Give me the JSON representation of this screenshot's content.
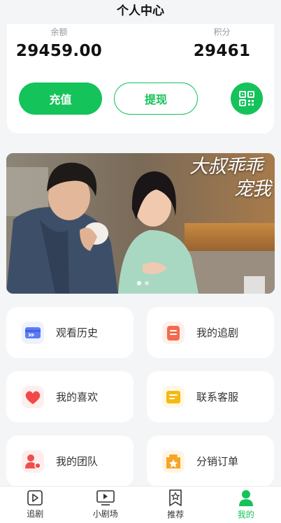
{
  "header": {
    "title": "个人中心"
  },
  "wallet": {
    "balance_label": "余额",
    "balance_value": "29459.00",
    "points_label": "积分",
    "points_value": "29461",
    "recharge_label": "充值",
    "withdraw_label": "提现",
    "qr_icon": "qr-code-icon"
  },
  "banner": {
    "title_line1": "大叔乖乖",
    "title_line2": "宠我",
    "slide_count": 2,
    "active_slide": 1
  },
  "menu": [
    {
      "label": "观看历史",
      "icon": "history-icon",
      "color": "#5b7cf5"
    },
    {
      "label": "我的追剧",
      "icon": "following-list-icon",
      "color": "#f26b4c"
    },
    {
      "label": "我的喜欢",
      "icon": "heart-icon",
      "color": "#f24848"
    },
    {
      "label": "联系客服",
      "icon": "customer-service-icon",
      "color": "#f5b914"
    },
    {
      "label": "我的团队",
      "icon": "team-icon",
      "color": "#f04e4e"
    },
    {
      "label": "分销订单",
      "icon": "distribution-order-icon",
      "color": "#f7a425"
    }
  ],
  "tabbar": [
    {
      "label": "追剧",
      "icon": "play-icon",
      "active": false
    },
    {
      "label": "小剧场",
      "icon": "tv-icon",
      "active": false
    },
    {
      "label": "推荐",
      "icon": "star-bookmark-icon",
      "active": false
    },
    {
      "label": "我的",
      "icon": "user-icon",
      "active": true
    }
  ],
  "colors": {
    "accent": "#14c35a",
    "background": "#f4f5f6"
  }
}
